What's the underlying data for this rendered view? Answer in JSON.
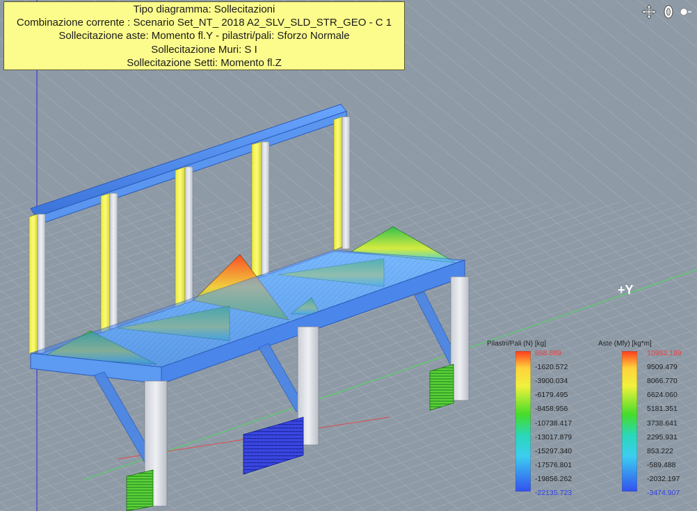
{
  "info_panel": {
    "lines": [
      "Tipo diagramma: Sollecitazioni",
      "Combinazione corrente : Scenario Set_NT_ 2018 A2_SLV_SLD_STR_GEO - C 1",
      "Sollecitazione aste: Momento fl.Y - pilastri/pali: Sforzo Normale",
      "Sollecitazione Muri: S I",
      "Sollecitazione Setti: Momento fl.Z"
    ]
  },
  "axis_label": "+Y",
  "toolbar_icons": [
    "move-icon",
    "orbit-icon",
    "light-icon"
  ],
  "legend_left": {
    "title": "Pilastri/Pali (N) [kg]",
    "labels": [
      "658.889",
      "-1620.572",
      "-3900.034",
      "-6179.495",
      "-8458.956",
      "-10738.417",
      "-13017.879",
      "-15297.340",
      "-17576.801",
      "-19856.262",
      "-22135.723"
    ]
  },
  "legend_right": {
    "title": "Aste (Mfy) [kg*m]",
    "labels": [
      "10952.189",
      "9509.479",
      "8066.770",
      "6624.060",
      "5181.351",
      "3738.641",
      "2295.931",
      "853.222",
      "-589.488",
      "-2032.197",
      "-3474.907"
    ]
  },
  "colors": {
    "background": "#8e9aa6",
    "grid_line": "#a6b0ba",
    "beam": "#4a86e8",
    "column": "#d7dbe1",
    "yellow_panel": "#fcfc8c",
    "max_label": "#e84040",
    "min_label": "#2f3fe0"
  }
}
